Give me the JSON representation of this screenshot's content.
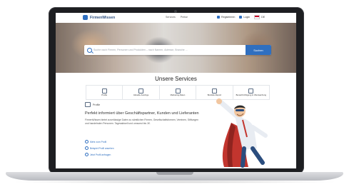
{
  "site": {
    "logo_text": "FirmenWissen",
    "nav_links": [
      "Services",
      "Preise"
    ],
    "nav_right": {
      "register": "Registrieren",
      "login": "Login",
      "language": "DE"
    }
  },
  "search": {
    "placeholder": "Suche nach Firmen, Personen und Produkten – nach Namen, Adresse, Branche ...",
    "button": "Suchen"
  },
  "services": {
    "title": "Unsere Services",
    "items": [
      {
        "label": "Profile",
        "icon": "profile-icon"
      },
      {
        "label": "Aktuelle Auszüge",
        "icon": "document-icon"
      },
      {
        "label": "Marketing-Daten",
        "icon": "chart-icon"
      },
      {
        "label": "Bonitäts-Report",
        "icon": "report-icon"
      },
      {
        "label": "Benachrichtigung & Überwachung",
        "icon": "bell-icon"
      }
    ]
  },
  "profile": {
    "tag": "Profile",
    "headline": "Perfekt informiert über Geschäftspartner, Kunden und Lieferanten",
    "body": "FirmenWissen bietet zuverlässige Daten zu sämtlichen Firmen, Gesellschaftsformen, Vereinen, Stiftungen und handelnden Personen. Tagesaktuell und umsonst bis 1€.",
    "links": [
      "Mehr zum Profil",
      "Beispiel Profil ansehen",
      "Jetzt Profil anfragen"
    ]
  },
  "colors": {
    "brand": "#2f6fc0",
    "laptop": "#1d1e21"
  }
}
